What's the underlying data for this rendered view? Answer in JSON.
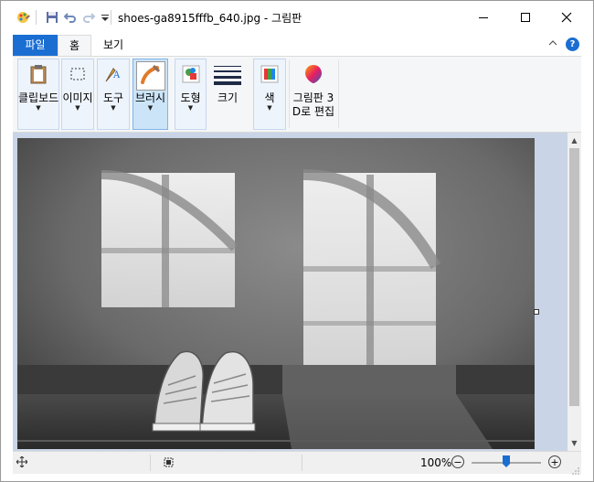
{
  "window": {
    "title": "shoes-ga8915fffb_640.jpg - 그림판"
  },
  "tabs": {
    "file": "파일",
    "home": "홈",
    "view": "보기"
  },
  "ribbon": {
    "groups": [
      {
        "label": "클립보드",
        "icon": "clipboard-icon"
      },
      {
        "label": "이미지",
        "icon": "select-icon"
      },
      {
        "label": "도구",
        "icon": "tools-icon"
      },
      {
        "label": "브러시",
        "icon": "brush-icon"
      },
      {
        "label": "도형",
        "icon": "shapes-icon"
      },
      {
        "label": "크기",
        "icon": "size-icon"
      },
      {
        "label": "색",
        "icon": "color-icon"
      },
      {
        "label_line1": "그림판 3",
        "label_line2": "D로 편집",
        "icon": "paint3d-icon"
      }
    ]
  },
  "statusbar": {
    "zoom": "100%",
    "zoom_level_percent": 100
  },
  "colors": {
    "accent": "#1a6ed2",
    "help": "#1a6ed2"
  }
}
